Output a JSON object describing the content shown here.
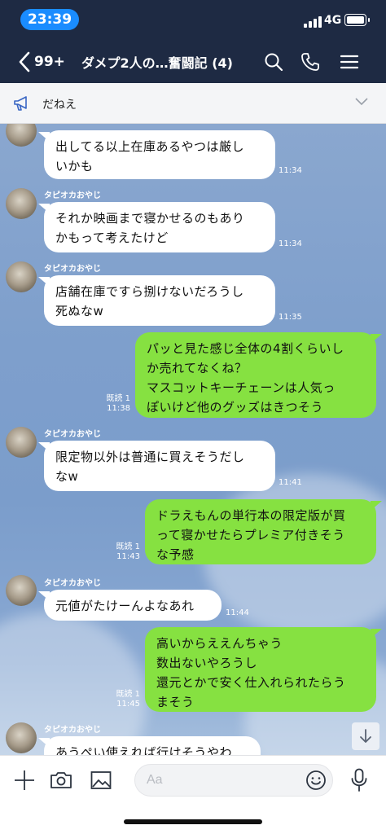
{
  "status": {
    "time": "23:39",
    "network": "4G"
  },
  "header": {
    "back_count": "99+",
    "title": "ダメプ2人の…奮闘記 (4)"
  },
  "announcement": {
    "text": "だねえ"
  },
  "messages": [
    {
      "side": "in",
      "sender": "",
      "text": "出してる以上在庫あるやつは厳し\nいかも",
      "time": "11:34"
    },
    {
      "side": "in",
      "sender": "タピオカおやじ",
      "text": "それか映画まで寝かせるのもあり\nかもって考えたけど",
      "time": "11:34"
    },
    {
      "side": "in",
      "sender": "タピオカおやじ",
      "text": "店舗在庫ですら捌けないだろうし\n死ぬなw",
      "time": "11:35"
    },
    {
      "side": "out",
      "read": "既読 1",
      "text": "パッと見た感じ全体の4割くらいし\nか売れてなくね？\nマスコットキーチェーンは人気っ\nぽいけど他のグッズはきつそう",
      "time": "11:38"
    },
    {
      "side": "in",
      "sender": "タピオカおやじ",
      "text": "限定物以外は普通に買えそうだし\nなw",
      "time": "11:41"
    },
    {
      "side": "out",
      "read": "既読 1",
      "text": "ドラえもんの単行本の限定版が買\nって寝かせたらプレミア付きそう\nな予感",
      "time": "11:43"
    },
    {
      "side": "in",
      "sender": "タピオカおやじ",
      "text": "元値がたけーんよなあれ",
      "time": "11:44"
    },
    {
      "side": "out",
      "read": "既読 1",
      "text": "高いからええんちゃう\n数出ないやろうし\n還元とかで安く仕入れられたらう\nまそう",
      "time": "11:45"
    },
    {
      "side": "in",
      "sender": "タピオカおやじ",
      "text": "あうぺい使えれば行けそうやわ",
      "time": ""
    }
  ],
  "input": {
    "placeholder": "Aa"
  },
  "icons": {
    "back": "chevron-left-icon",
    "search": "search-icon",
    "call": "phone-icon",
    "menu": "menu-icon",
    "announce": "megaphone-icon",
    "expand": "chevron-down-icon",
    "plus": "plus-icon",
    "camera": "camera-icon",
    "image": "image-icon",
    "emoji": "emoji-icon",
    "mic": "mic-icon",
    "scroll": "arrow-down-icon"
  },
  "colors": {
    "header_bg": "#1e2a43",
    "time_pill": "#1a8cff",
    "outgoing_bubble": "#86e141",
    "incoming_bubble": "#ffffff"
  }
}
